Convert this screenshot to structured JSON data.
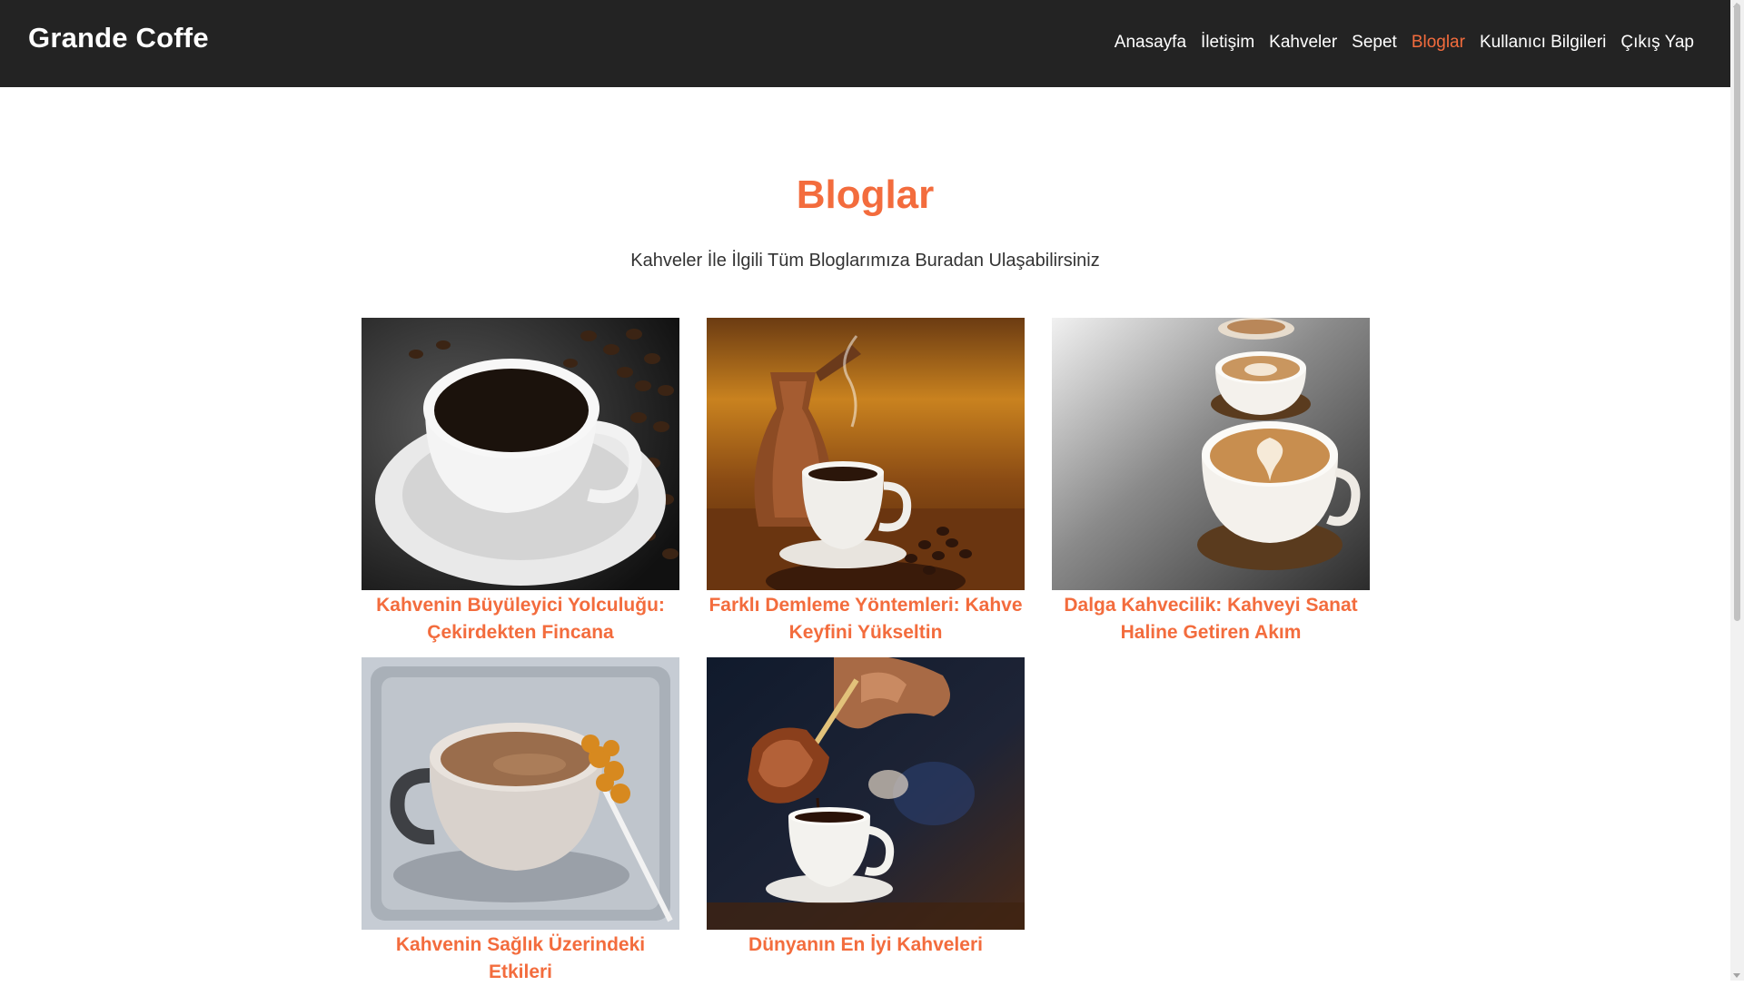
{
  "header": {
    "brand": "Grande Coffe",
    "nav": [
      {
        "label": "Anasayfa"
      },
      {
        "label": "İletişim"
      },
      {
        "label": "Kahveler"
      },
      {
        "label": "Sepet"
      },
      {
        "label": "Bloglar",
        "active": true
      },
      {
        "label": "Kullanıcı Bilgileri"
      },
      {
        "label": "Çıkış Yap"
      }
    ]
  },
  "main": {
    "title": "Bloglar",
    "subtitle": "Kahveler İle İlgili Tüm Bloglarımıza Buradan Ulaşabilirsiniz",
    "posts": [
      {
        "title": "Kahvenin Büyüleyici Yolculuğu: Çekirdekten Fincana",
        "image": "coffee-cup-beans-photo"
      },
      {
        "title": "Farklı Demleme Yöntemleri: Kahve Keyfini Yükseltin",
        "image": "turkish-coffee-pot-photo"
      },
      {
        "title": "Dalga Kahvecilik: Kahveyi Sanat Haline Getiren Akım",
        "image": "latte-art-cups-photo"
      },
      {
        "title": "Kahvenin Sağlık Üzerindeki Etkileri",
        "image": "coffee-cup-tray-photo"
      },
      {
        "title": "Dünyanın En İyi Kahveleri",
        "image": "pouring-turkish-coffee-photo"
      }
    ]
  },
  "colors": {
    "accent": "#f36c3d",
    "header_bg": "#232323"
  }
}
